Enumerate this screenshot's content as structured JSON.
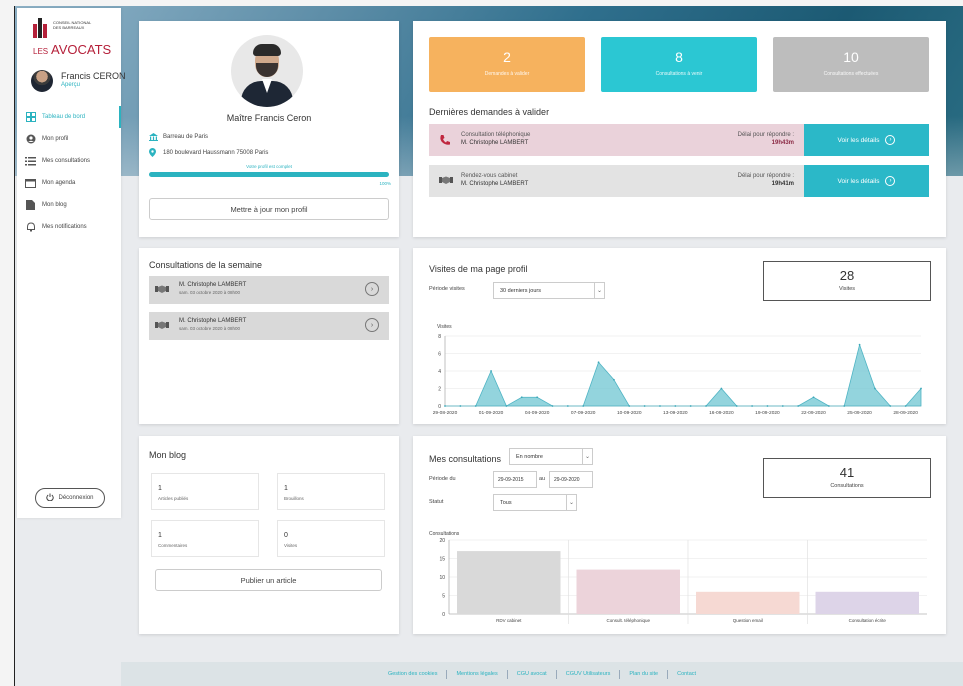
{
  "brand": {
    "org_line1": "CONSEIL NATIONAL",
    "org_line2": "DES BARREAUX",
    "brand_small": "LES",
    "brand_big": "AVOCATS"
  },
  "user": {
    "name": "Francis CERON",
    "sub": "Aperçu"
  },
  "nav": [
    {
      "label": "Tableau de bord",
      "icon": "dashboard-icon",
      "active": true
    },
    {
      "label": "Mon profil",
      "icon": "user-icon"
    },
    {
      "label": "Mes consultations",
      "icon": "list-icon"
    },
    {
      "label": "Mon agenda",
      "icon": "calendar-icon"
    },
    {
      "label": "Mon blog",
      "icon": "document-icon"
    },
    {
      "label": "Mes notifications",
      "icon": "bell-icon"
    }
  ],
  "logout": "Déconnexion",
  "profile": {
    "name": "Maître Francis Ceron",
    "bar": "Barreau de Paris",
    "address": "180 boulevard Haussmann 75008 Paris",
    "progress_label": "Votre profil est complet",
    "progress": 100,
    "progress_pct": "100%",
    "update_button": "Mettre à jour mon profil"
  },
  "stats": [
    {
      "value": "2",
      "label": "Demandes à valider",
      "color": "#f6b25e"
    },
    {
      "value": "8",
      "label": "Consultations à venir",
      "color": "#2bc7d3"
    },
    {
      "value": "10",
      "label": "Consultations effectuées",
      "color": "#bdbdbd"
    }
  ],
  "requests": {
    "title": "Dernières demandes à valider",
    "items": [
      {
        "type": "Consultation téléphonique",
        "client": "M. Christophe LAMBERT",
        "delay_label": "Délai pour répondre :",
        "delay": "19h43m",
        "bg": "#ead2da",
        "icon": "phone-icon",
        "action": "Voir les détails"
      },
      {
        "type": "Rendez-vous cabinet",
        "client": "M. Christophe LAMBERT",
        "delay_label": "Délai pour répondre :",
        "delay": "19h41m",
        "bg": "#e3e3e3",
        "icon": "handshake-icon",
        "action": "Voir les détails"
      }
    ]
  },
  "week": {
    "title": "Consultations de la semaine",
    "items": [
      {
        "client": "M. Christophe LAMBERT",
        "date": "sam. 03 octobre 2020 à 08h00"
      },
      {
        "client": "M. Christophe LAMBERT",
        "date": "sam. 03 octobre 2020 à 08h00"
      }
    ]
  },
  "visits": {
    "title": "Visites de ma page profil",
    "period_label": "Période visites",
    "period_value": "30 derniers jours",
    "count": "28",
    "count_label": "Visites",
    "y_label": "Visites"
  },
  "blog": {
    "title": "Mon blog",
    "boxes": [
      {
        "value": "1",
        "label": "Articles publiés"
      },
      {
        "value": "1",
        "label": "Brouillons"
      },
      {
        "value": "1",
        "label": "Commentaires"
      },
      {
        "value": "0",
        "label": "Visites"
      }
    ],
    "publish_button": "Publier un article"
  },
  "consults": {
    "title": "Mes consultations",
    "mode_value": "En nombre",
    "period_label": "Période du",
    "date_from": "29-09-2015",
    "au": "au",
    "date_to": "29-09-2020",
    "status_label": "Statut",
    "status_value": "Tous",
    "count": "41",
    "count_label": "Consultations",
    "y_label": "Consultations"
  },
  "chart_data": [
    {
      "type": "area",
      "ylabel": "Visites",
      "ylim": [
        0,
        8
      ],
      "yticks": [
        0,
        2,
        4,
        6,
        8
      ],
      "x_tick_labels": [
        "29-08-2020",
        "01-09-2020",
        "04-09-2020",
        "07-09-2020",
        "10-09-2020",
        "13-09-2020",
        "16-09-2020",
        "19-09-2020",
        "22-09-2020",
        "25-09-2020",
        "28-09-2020"
      ],
      "x": [
        "29-08",
        "30-08",
        "31-08",
        "01-09",
        "02-09",
        "03-09",
        "04-09",
        "05-09",
        "06-09",
        "07-09",
        "08-09",
        "09-09",
        "10-09",
        "11-09",
        "12-09",
        "13-09",
        "14-09",
        "15-09",
        "16-09",
        "17-09",
        "18-09",
        "19-09",
        "20-09",
        "21-09",
        "22-09",
        "23-09",
        "24-09",
        "25-09",
        "26-09",
        "27-09",
        "28-09",
        "29-09"
      ],
      "values": [
        0,
        0,
        0,
        4,
        0,
        1,
        1,
        0,
        0,
        0,
        5,
        3,
        0,
        0,
        0,
        0,
        0,
        0,
        2,
        0,
        0,
        0,
        0,
        0,
        1,
        0,
        0,
        7,
        2,
        0,
        0,
        2
      ],
      "color": "#6fc5d2",
      "grid": true
    },
    {
      "type": "bar",
      "ylabel": "Consultations",
      "ylim": [
        0,
        20
      ],
      "yticks": [
        0,
        5,
        10,
        15,
        20
      ],
      "categories": [
        "RDV cabinet",
        "Consult. téléphonique",
        "Question email",
        "Consultation écrite"
      ],
      "values": [
        17,
        12,
        6,
        6
      ],
      "colors": [
        "#d9d9d9",
        "#ecd3da",
        "#f6d9d3",
        "#ddd4e8"
      ],
      "grid": true
    }
  ],
  "footer": [
    "Gestion des cookies",
    "Mentions légales",
    "CGU avocat",
    "CGUV Utilisateurs",
    "Plan du site",
    "Contact"
  ]
}
